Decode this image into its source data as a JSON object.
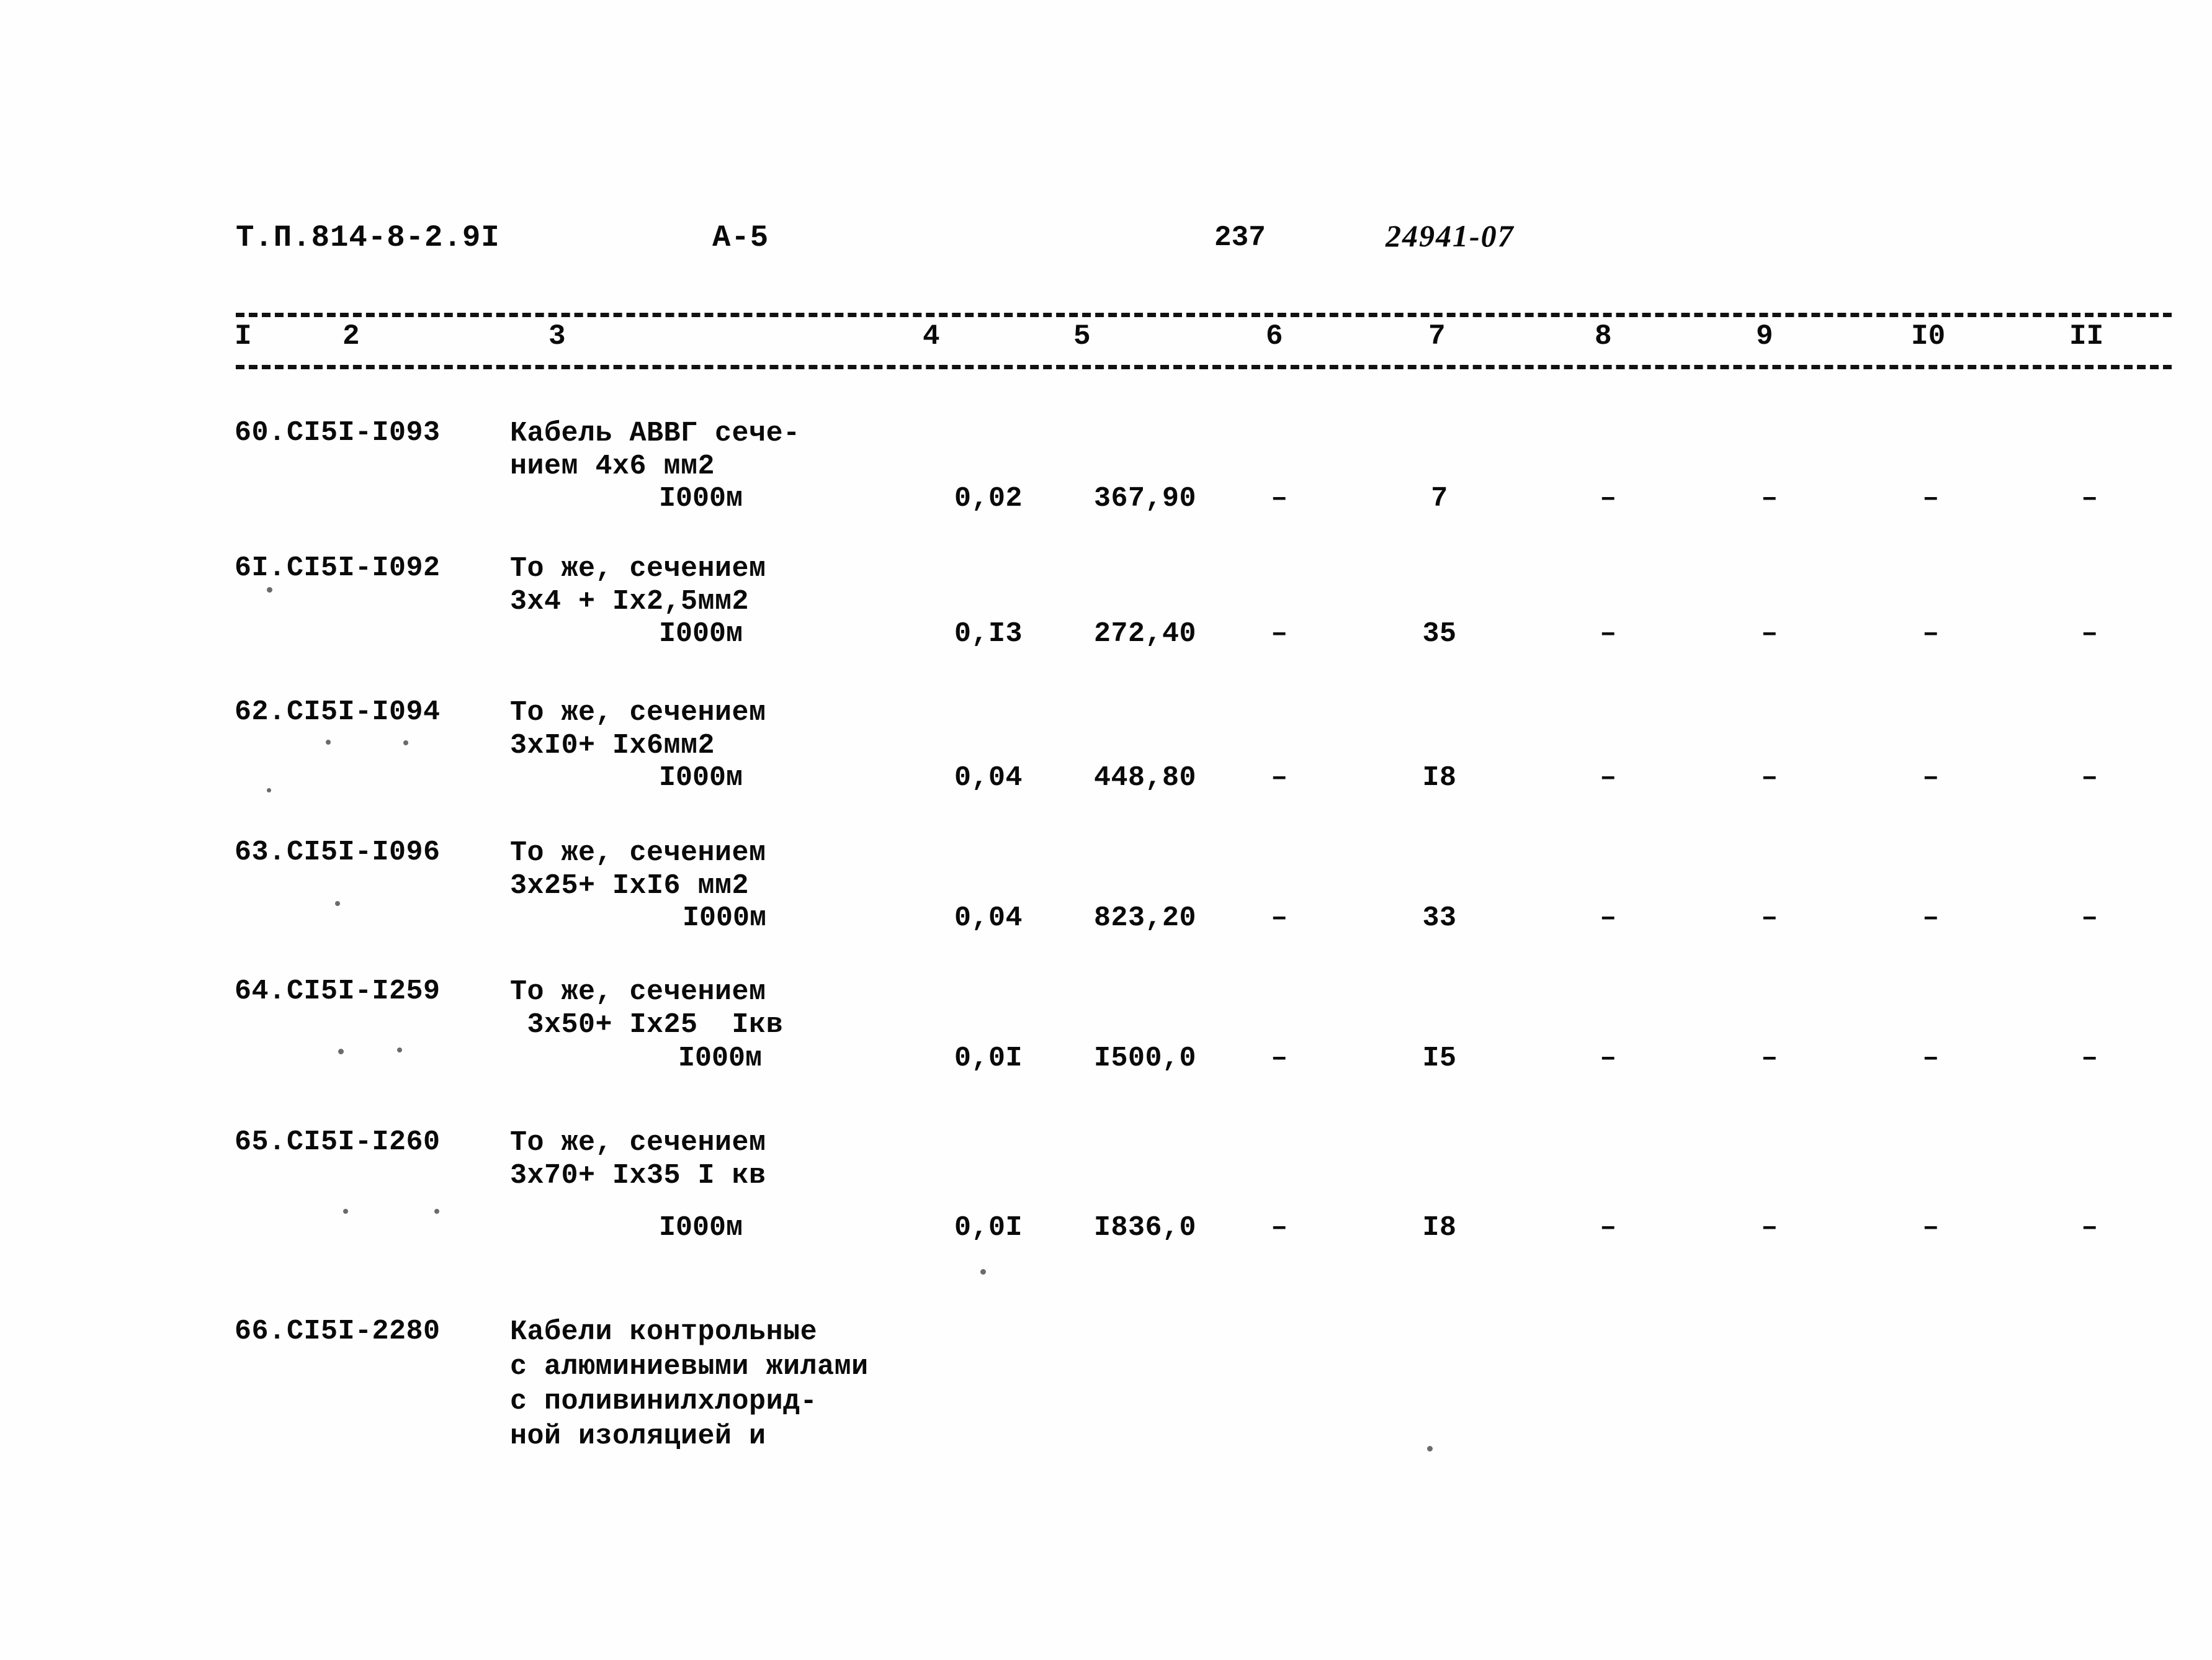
{
  "header": {
    "doc_code": "Т.П.814-8-2.9I",
    "sheet": "А-5",
    "page_number": "237",
    "stamp": "24941-07"
  },
  "table": {
    "column_headers": [
      "I",
      "2",
      "3",
      "4",
      "5",
      "6",
      "7",
      "8",
      "9",
      "I0",
      "II"
    ],
    "dash_value": "–",
    "rows": [
      {
        "num": "60.",
        "code": "СI5I-I093",
        "desc_line1": "Кабель АВВГ сече-",
        "desc_line2": "нием 4х6 мм2",
        "desc_line3": "",
        "desc_line4": "",
        "unit": "I000м",
        "qty": "0,02",
        "price": "367,90",
        "col6": "–",
        "col7": "7",
        "col8": "–",
        "col9": "–",
        "col10": "–",
        "col11": "–"
      },
      {
        "num": "6I.",
        "code": "СI5I-I092",
        "desc_line1": "То же, сечением",
        "desc_line2": "3х4 + Iх2,5мм2",
        "desc_line3": "",
        "desc_line4": "",
        "unit": "I000м",
        "qty": "0,I3",
        "price": "272,40",
        "col6": "–",
        "col7": "35",
        "col8": "–",
        "col9": "–",
        "col10": "–",
        "col11": "–"
      },
      {
        "num": "62.",
        "code": "СI5I-I094",
        "desc_line1": "То же, сечением",
        "desc_line2": "3хI0+ Iх6мм2",
        "desc_line3": "",
        "desc_line4": "",
        "unit": "I000м",
        "qty": "0,04",
        "price": "448,80",
        "col6": "–",
        "col7": "I8",
        "col8": "–",
        "col9": "–",
        "col10": "–",
        "col11": "–"
      },
      {
        "num": "63.",
        "code": "СI5I-I096",
        "desc_line1": "То же, сечением",
        "desc_line2": "3х25+ IхI6 мм2",
        "desc_line3": "",
        "desc_line4": "",
        "unit": "I000м",
        "qty": "0,04",
        "price": "823,20",
        "col6": "–",
        "col7": "33",
        "col8": "–",
        "col9": "–",
        "col10": "–",
        "col11": "–"
      },
      {
        "num": "64.",
        "code": "СI5I-I259",
        "desc_line1": "То же, сечением",
        "desc_line2": " 3х50+ Iх25  Iкв",
        "desc_line3": "",
        "desc_line4": "",
        "unit": "I000м",
        "qty": "0,0I",
        "price": "I500,0",
        "col6": "–",
        "col7": "I5",
        "col8": "–",
        "col9": "–",
        "col10": "–",
        "col11": "–"
      },
      {
        "num": "65.",
        "code": "СI5I-I260",
        "desc_line1": "То же, сечением",
        "desc_line2": "3х70+ Iх35 I кв",
        "desc_line3": "",
        "desc_line4": "",
        "unit": "I000м",
        "qty": "0,0I",
        "price": "I836,0",
        "col6": "–",
        "col7": "I8",
        "col8": "–",
        "col9": "–",
        "col10": "–",
        "col11": "–"
      },
      {
        "num": "66.",
        "code": "СI5I-2280",
        "desc_line1": "Кабели контрольные",
        "desc_line2": "с алюминиевыми жилами",
        "desc_line3": "с поливинилхлорид-",
        "desc_line4": "ной изоляцией и",
        "unit": "",
        "qty": "",
        "price": "",
        "col6": "",
        "col7": "",
        "col8": "",
        "col9": "",
        "col10": "",
        "col11": ""
      }
    ]
  }
}
